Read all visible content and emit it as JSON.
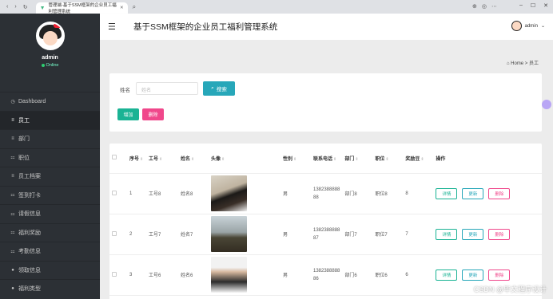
{
  "browser": {
    "tab_title": "管理端-基于SSM框架的企业员工福利管理系统"
  },
  "sidebar": {
    "username": "admin",
    "status": "Online",
    "items": [
      {
        "label": "Dashboard",
        "icon": "dashboard-icon"
      },
      {
        "label": "员工",
        "icon": "list-icon"
      },
      {
        "label": "部门",
        "icon": "list-icon"
      },
      {
        "label": "职位",
        "icon": "grid-icon"
      },
      {
        "label": "员工档案",
        "icon": "list-icon"
      },
      {
        "label": "签到打卡",
        "icon": "grid-icon"
      },
      {
        "label": "请假信息",
        "icon": "grid-icon"
      },
      {
        "label": "福利奖励",
        "icon": "grid-icon"
      },
      {
        "label": "考勤信息",
        "icon": "grid-icon"
      },
      {
        "label": "领取信息",
        "icon": "user-icon"
      },
      {
        "label": "福利类型",
        "icon": "user-icon"
      }
    ]
  },
  "header": {
    "title": "基于SSM框架的企业员工福利管理系统",
    "user": "admin"
  },
  "breadcrumb": {
    "home": "Home",
    "sep": ">",
    "current": "员工"
  },
  "search": {
    "label": "姓名",
    "placeholder": "姓名",
    "button": "搜索"
  },
  "actions": {
    "add": "增加",
    "delete": "删除"
  },
  "table": {
    "headers": [
      "序号",
      "工号",
      "姓名",
      "头像",
      "性别",
      "联系电话",
      "部门",
      "职位",
      "奖励豆",
      "操作"
    ],
    "sortable": [
      true,
      true,
      true,
      true,
      true,
      true,
      true,
      true,
      true,
      false
    ],
    "rows": [
      {
        "no": "1",
        "emp_id": "工号8",
        "name": "姓名8",
        "gender": "男",
        "phone_a": "1382388888",
        "phone_b": "88",
        "dept": "部门8",
        "pos": "职位8",
        "bonus": "8"
      },
      {
        "no": "2",
        "emp_id": "工号7",
        "name": "姓名7",
        "gender": "男",
        "phone_a": "1382388888",
        "phone_b": "87",
        "dept": "部门7",
        "pos": "职位7",
        "bonus": "7"
      },
      {
        "no": "3",
        "emp_id": "工号6",
        "name": "姓名6",
        "gender": "男",
        "phone_a": "1382388888",
        "phone_b": "86",
        "dept": "部门6",
        "pos": "职位6",
        "bonus": "6"
      }
    ],
    "ops": {
      "detail": "详情",
      "update": "更新",
      "delete": "删除"
    }
  },
  "watermark": "CSDN @毕文程序设计"
}
